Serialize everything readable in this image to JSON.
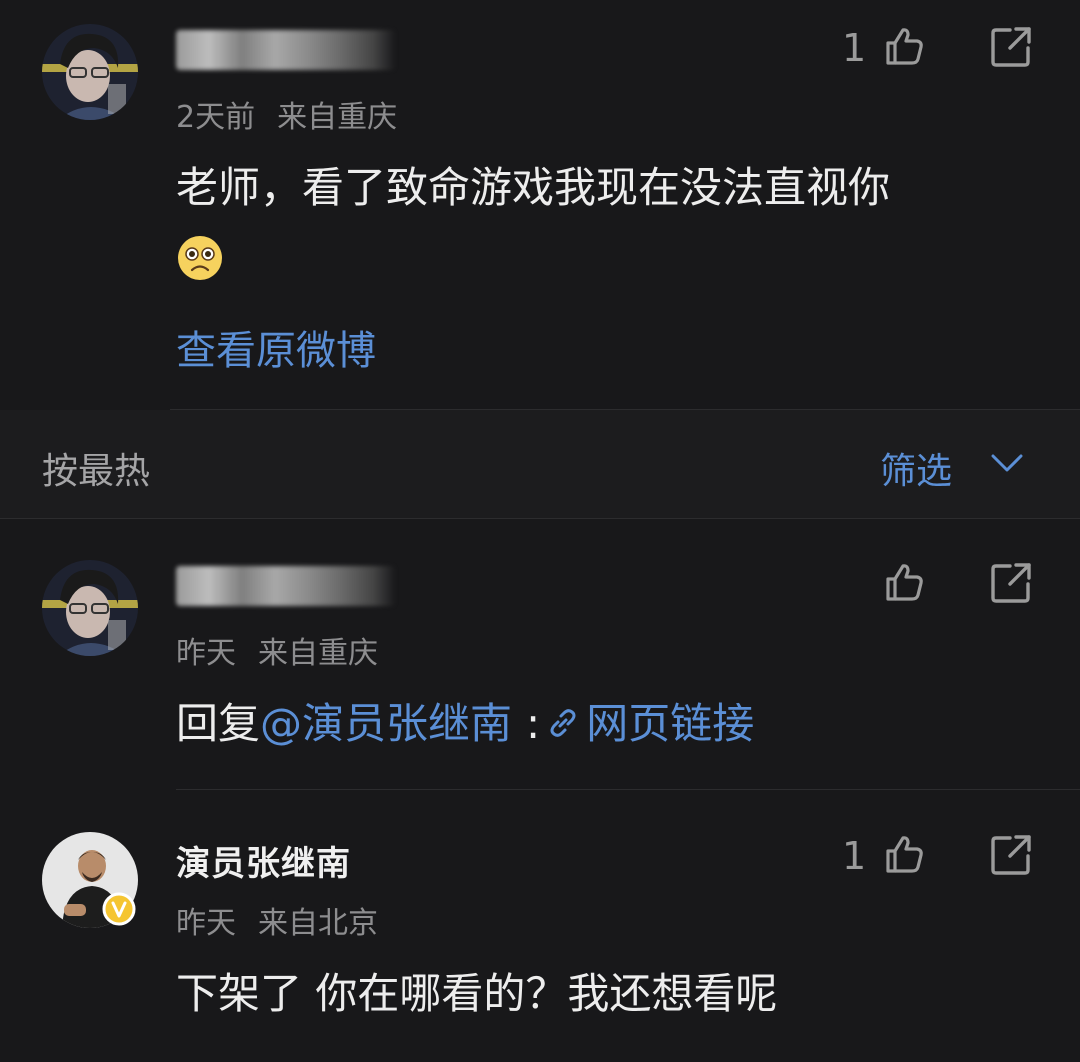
{
  "comment_top": {
    "meta_time": "2天前",
    "meta_location": "来自重庆",
    "text": "老师，看了致命游戏我现在没法直视你",
    "like_count": "1",
    "view_original": "查看原微博"
  },
  "sort_bar": {
    "sort_label": "按最热",
    "filter_label": "筛选"
  },
  "reply_1": {
    "meta_time": "昨天",
    "meta_location": "来自重庆",
    "reply_prefix": "回复",
    "mention": "@演员张继南",
    "colon": ":",
    "link_text": "网页链接"
  },
  "reply_2": {
    "name": "演员张继南",
    "meta_time": "昨天",
    "meta_location": "来自北京",
    "text": "下架了 你在哪看的？我还想看呢",
    "like_count": "1"
  },
  "colors": {
    "background": "#18181a",
    "link": "#5b8fd6",
    "verified_badge": "#f5c531"
  }
}
